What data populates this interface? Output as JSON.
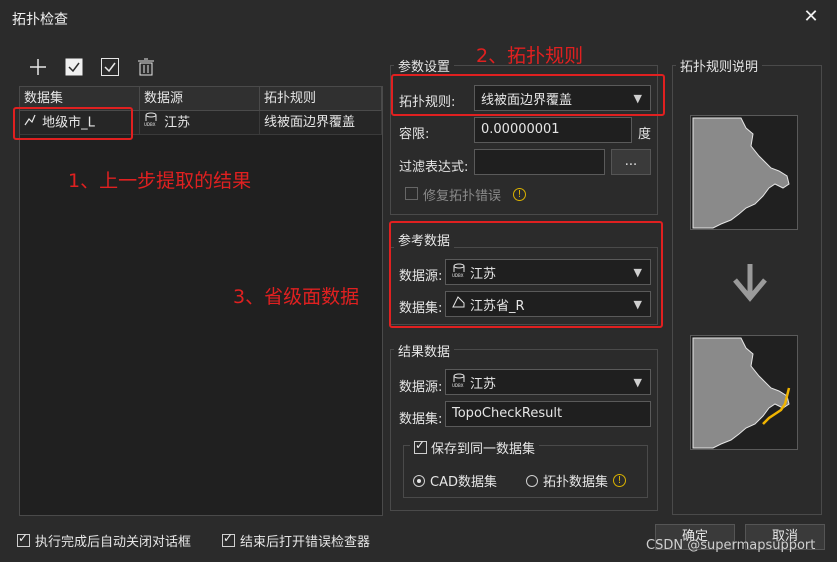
{
  "window": {
    "title": "拓扑检查",
    "close_symbol": "✕"
  },
  "toolbar": {
    "add": "+",
    "check_all": "check-all",
    "select_all": "select-all",
    "delete": "delete"
  },
  "grid": {
    "headers": [
      "数据集",
      "数据源",
      "拓扑规则"
    ],
    "row": {
      "dataset": "地级市_L",
      "datasource": "江苏",
      "rule": "线被面边界覆盖"
    }
  },
  "params": {
    "legend": "参数设置",
    "rule_label": "拓扑规则:",
    "rule_value": "线被面边界覆盖",
    "tolerance_label": "容限:",
    "tolerance_value": "0.00000001",
    "tolerance_unit": "度",
    "filter_label": "过滤表达式:",
    "filter_value": "",
    "filter_button": "...",
    "repair_label": "修复拓扑错误"
  },
  "reference": {
    "legend": "参考数据",
    "datasource_label": "数据源:",
    "datasource_value": "江苏",
    "dataset_label": "数据集:",
    "dataset_value": "江苏省_R"
  },
  "result": {
    "legend": "结果数据",
    "datasource_label": "数据源:",
    "datasource_value": "江苏",
    "dataset_label": "数据集:",
    "dataset_value": "TopoCheckResult",
    "save_same_label": "保存到同一数据集",
    "radio_cad": "CAD数据集",
    "radio_topo": "拓扑数据集"
  },
  "description": {
    "legend": "拓扑规则说明"
  },
  "footer": {
    "auto_close": "执行完成后自动关闭对话框",
    "open_checker": "结束后打开错误检查器",
    "ok": "确定",
    "cancel": "取消"
  },
  "annotations": {
    "a1": "1、上一步提取的结果",
    "a2": "2、拓扑规则",
    "a3": "3、省级面数据"
  },
  "watermark": "CSDN @supermapsupport",
  "colors": {
    "background": "#2b2b2b",
    "annotation": "#e02020",
    "warning": "#d9b100",
    "highlight_line": "#f0b400"
  }
}
